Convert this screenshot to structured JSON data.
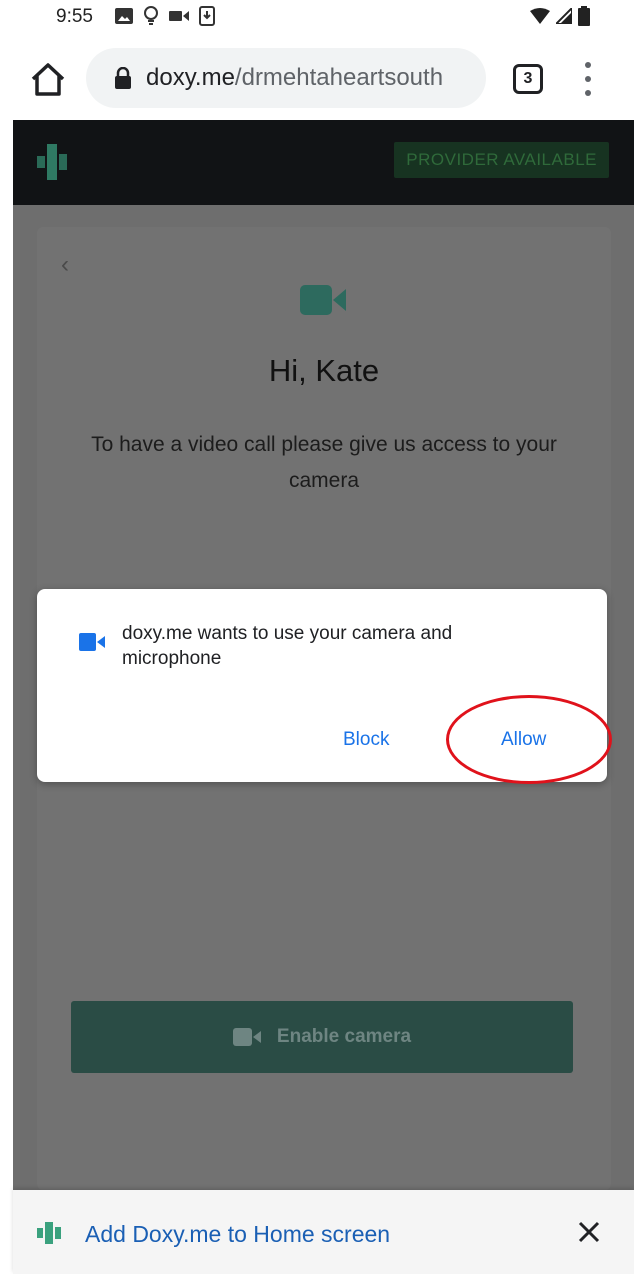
{
  "status_bar": {
    "time": "9:55"
  },
  "browser": {
    "url_domain": "doxy.me",
    "url_path": "/drmehtaheartsouth",
    "tab_count": "3"
  },
  "page": {
    "provider_status": "PROVIDER AVAILABLE",
    "greeting": "Hi, Kate",
    "prompt": "To have a video call please give us access to your camera",
    "enable_camera_label": "Enable camera"
  },
  "permission_dialog": {
    "message": "doxy.me wants to use your camera and microphone",
    "block_label": "Block",
    "allow_label": "Allow"
  },
  "install_banner": {
    "text": "Add Doxy.me to Home screen"
  },
  "colors": {
    "brand_green": "#3aa17e",
    "link_blue": "#1a73e8",
    "highlight_red": "#e0121b"
  }
}
